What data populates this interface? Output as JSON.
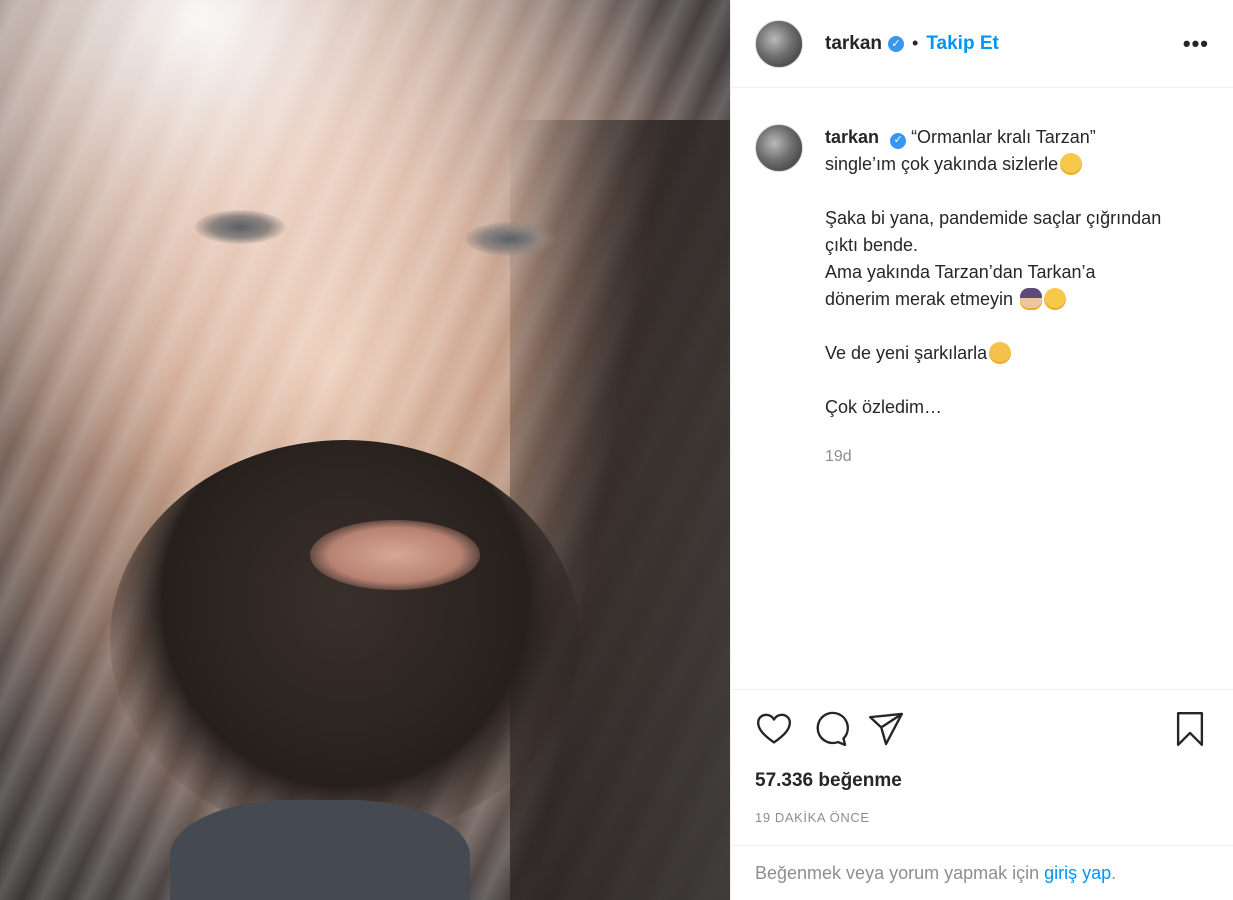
{
  "post": {
    "username": "tarkan",
    "follow_label": "Takip Et",
    "dot": "•",
    "more": "•••"
  },
  "caption": {
    "username": "tarkan",
    "line1": "“Ormanlar kralı Tarzan”",
    "line2": "single’ım çok yakında sizlerle",
    "para2_line1": "Şaka bi yana, pandemide saçlar çığrından",
    "para2_line2": "çıktı bende.",
    "para2_line3": "Ama yakında Tarzan’dan Tarkan’a",
    "para2_line4": "dönerim merak etmeyin",
    "para3": "Ve de yeni şarkılarla",
    "para4": "Çok özledim…",
    "timestamp": "19d"
  },
  "actions": {
    "likes": "57.336 beğenme",
    "ago": "19 DAKİKA ÖNCE"
  },
  "login": {
    "text": "Beğenmek veya yorum yapmak için",
    "link": "giriş yap",
    "suffix": "."
  },
  "icons": {
    "verified": "verified-badge-icon",
    "like": "heart-icon",
    "comment": "comment-icon",
    "share": "send-icon",
    "save": "bookmark-icon"
  },
  "colors": {
    "accent": "#0095f6",
    "verified": "#3897f0",
    "muted": "#8e8e8e",
    "text": "#262626"
  }
}
